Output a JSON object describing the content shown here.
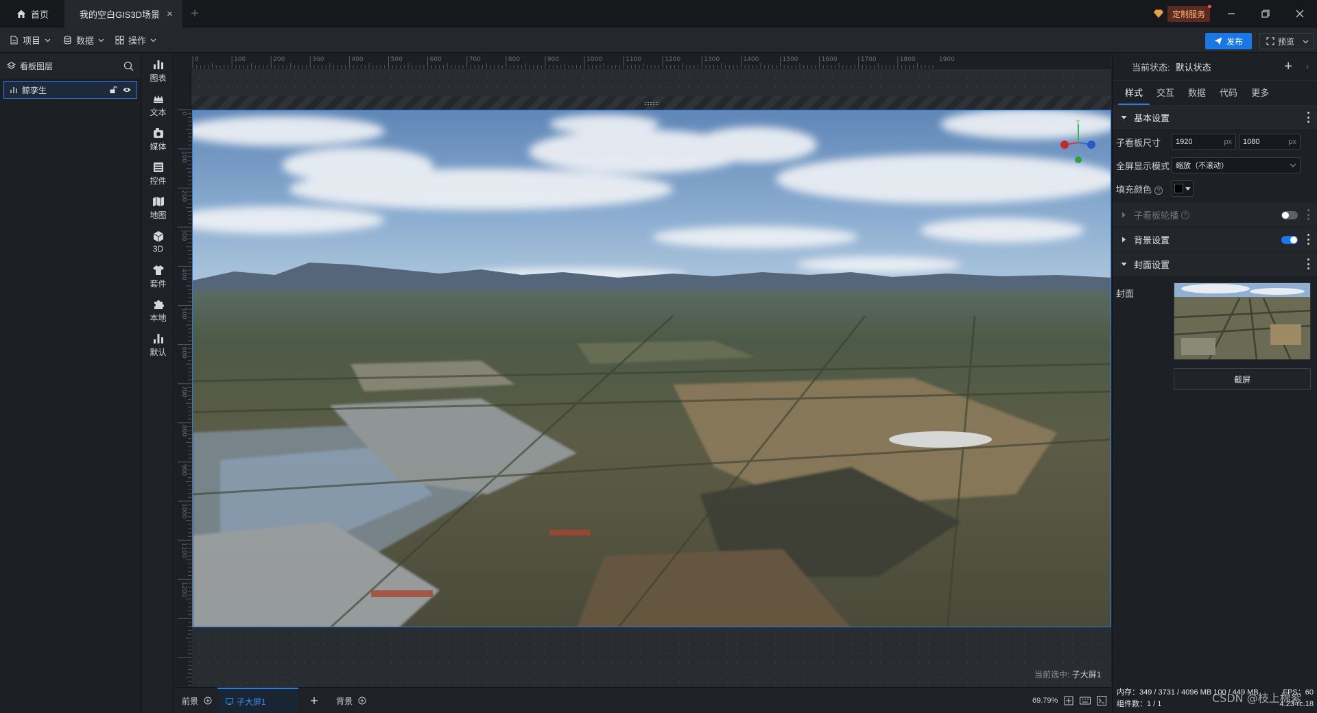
{
  "titlebar": {
    "home_tab": "首页",
    "scene_tab": "我的空白GIS3D场景",
    "close_symbol": "×",
    "add_symbol": "+",
    "custom_service": "定制服务"
  },
  "menubar": {
    "project": "项目",
    "data": "数据",
    "operate": "操作",
    "publish": "发布",
    "preview": "预览"
  },
  "layers": {
    "title": "看板图层",
    "items": [
      {
        "label": "鲸孪生"
      }
    ]
  },
  "components": [
    {
      "label": "图表",
      "icon": "bar-chart-icon"
    },
    {
      "label": "文本",
      "icon": "text-icon"
    },
    {
      "label": "媒体",
      "icon": "media-icon"
    },
    {
      "label": "控件",
      "icon": "widget-icon"
    },
    {
      "label": "地图",
      "icon": "map-icon"
    },
    {
      "label": "3D",
      "icon": "cube-icon"
    },
    {
      "label": "套件",
      "icon": "kit-icon"
    },
    {
      "label": "本地",
      "icon": "puzzle-icon"
    },
    {
      "label": "默认",
      "icon": "default-chart-icon"
    }
  ],
  "ruler": {
    "h_ticks": [
      "0",
      "100",
      "200",
      "300",
      "400",
      "500",
      "600",
      "700",
      "800",
      "900",
      "1000",
      "1100",
      "1200",
      "1300",
      "1400",
      "1500",
      "1600",
      "1700",
      "1800",
      "1900"
    ],
    "v_ticks": [
      "0",
      "100",
      "200",
      "300",
      "400",
      "500",
      "600",
      "700",
      "800",
      "900",
      "1000",
      "1100",
      "1200"
    ]
  },
  "canvas": {
    "status_label": "当前选中:",
    "status_value": "子大屏1"
  },
  "bottombar": {
    "front": "前景",
    "sub_screen": "子大屏1",
    "background": "背景",
    "zoom": "69.79%"
  },
  "props": {
    "state_label": "当前状态:",
    "state_value": "默认状态",
    "tabs": [
      "样式",
      "交互",
      "数据",
      "代码",
      "更多"
    ],
    "active_tab": "样式",
    "basic_settings": "基本设置",
    "sub_size_label": "子看板尺寸",
    "width": "1920",
    "height": "1080",
    "unit": "px",
    "fullscreen_label": "全屏显示模式",
    "fullscreen_value": "缩放（不滚动）",
    "fill_label": "填充颜色",
    "fill_color": "#000000",
    "carousel": "子看板轮播",
    "carousel_on": false,
    "bg_settings": "背景设置",
    "bg_on": true,
    "cover_settings": "封面设置",
    "cover_label": "封面",
    "screenshot_btn": "截屏"
  },
  "sysinfo": {
    "memory": "内存：349 / 3731 / 4096 MB  100 / 449 MB",
    "fps": "FPS：60",
    "components": "组件数：1 / 1",
    "version": "4.23-rc.18"
  },
  "watermark": "CSDN @枝上棉絮",
  "colors": {
    "accent": "#2d7be0",
    "publish": "#1a78e6"
  }
}
